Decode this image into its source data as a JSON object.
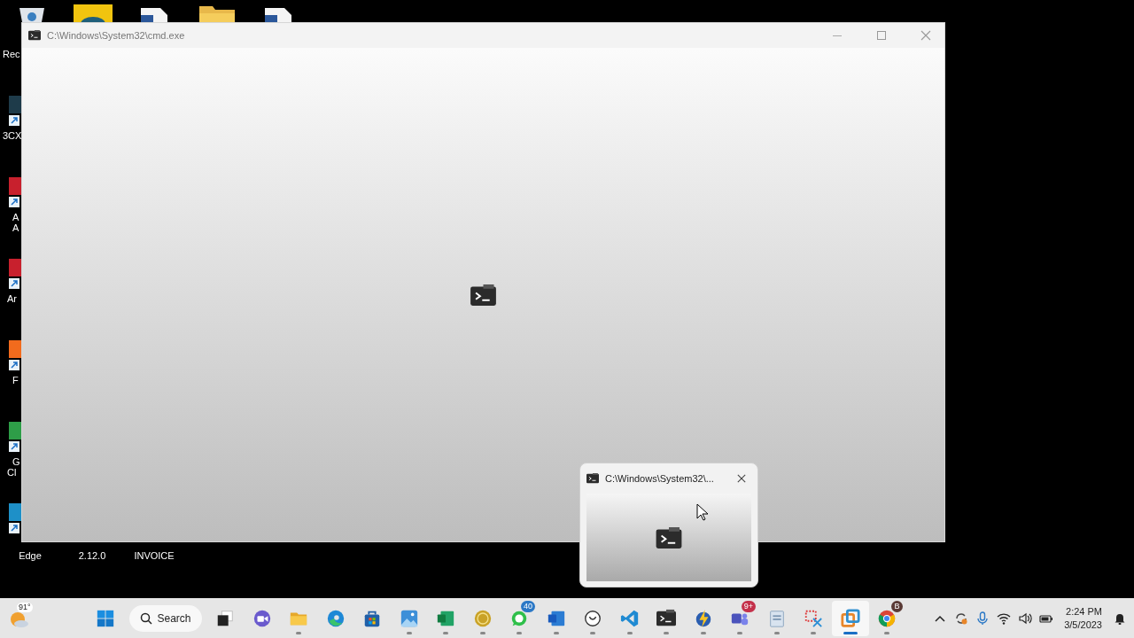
{
  "desktop": {
    "top_icons": [
      {
        "kind": "recycle"
      },
      {
        "kind": "yellow-app"
      },
      {
        "kind": "document"
      },
      {
        "kind": "folder"
      },
      {
        "kind": "document"
      }
    ],
    "left_icons": [
      {
        "kind": "recycle",
        "label_lines": [
          "Rec"
        ]
      },
      {
        "kind": "teal-app",
        "label_lines": [
          "3CX"
        ]
      },
      {
        "kind": "red-app",
        "label_lines": [
          "A",
          "A"
        ]
      },
      {
        "kind": "red-app",
        "label_lines": [
          "Ar"
        ]
      },
      {
        "kind": "firefox",
        "label_lines": [
          "F"
        ]
      },
      {
        "kind": "chrome",
        "label_lines": [
          "G",
          "Cl"
        ]
      },
      {
        "kind": "edge"
      }
    ],
    "bottom_labels": [
      "Edge",
      "2.12.0",
      "INVOICE"
    ]
  },
  "window": {
    "title": "C:\\Windows\\System32\\cmd.exe"
  },
  "preview": {
    "title": "C:\\Windows\\System32\\..."
  },
  "taskbar": {
    "weather": {
      "temperature": "91°"
    },
    "items": [
      {
        "kind": "start",
        "running": false,
        "selected": false
      },
      {
        "kind": "search",
        "label": "Search"
      },
      {
        "kind": "taskview",
        "running": false,
        "selected": false
      },
      {
        "kind": "chat",
        "running": false,
        "selected": false
      },
      {
        "kind": "explorer",
        "running": true,
        "selected": false
      },
      {
        "kind": "edge",
        "running": false,
        "selected": false
      },
      {
        "kind": "store",
        "running": false,
        "selected": false
      },
      {
        "kind": "photos",
        "running": true,
        "selected": false
      },
      {
        "kind": "excel",
        "running": true,
        "selected": false
      },
      {
        "kind": "gold",
        "running": true,
        "selected": false
      },
      {
        "kind": "whatsapp",
        "running": true,
        "selected": false,
        "badge": "40"
      },
      {
        "kind": "word",
        "running": true,
        "selected": false
      },
      {
        "kind": "cy",
        "running": true,
        "selected": false
      },
      {
        "kind": "vscode",
        "running": true,
        "selected": false
      },
      {
        "kind": "terminal",
        "running": true,
        "selected": false
      },
      {
        "kind": "bolt",
        "running": true,
        "selected": false
      },
      {
        "kind": "teams",
        "running": true,
        "selected": false,
        "badge": "9+"
      },
      {
        "kind": "notepad",
        "running": true,
        "selected": false
      },
      {
        "kind": "snip",
        "running": true,
        "selected": false
      },
      {
        "kind": "vmware",
        "running": true,
        "selected": true
      },
      {
        "kind": "chrome",
        "running": true,
        "selected": false,
        "badge": "B"
      }
    ],
    "tray": [
      {
        "kind": "chevron"
      },
      {
        "kind": "sync"
      },
      {
        "kind": "mic"
      },
      {
        "kind": "wifi"
      },
      {
        "kind": "volume"
      },
      {
        "kind": "battery"
      }
    ],
    "clock": {
      "time": "2:24 PM",
      "date": "3/5/2023"
    }
  }
}
